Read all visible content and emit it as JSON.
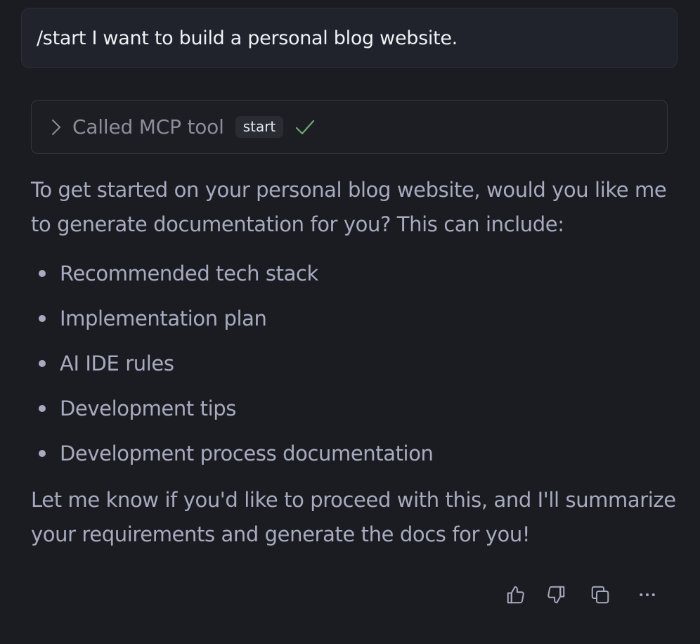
{
  "user_message": {
    "text": "/start I want to build a personal blog website."
  },
  "tool_call": {
    "label": "Called MCP tool",
    "tool_name": "start",
    "status": "success",
    "icons": {
      "expand": "chevron-right-icon",
      "status": "checkmark-icon"
    },
    "status_color": "#6aa874"
  },
  "assistant_message": {
    "intro": "To get started on your personal blog website, would you like me to generate documentation for you? This can include:",
    "items": [
      "Recommended tech stack",
      "Implementation plan",
      "AI IDE rules",
      "Development tips",
      "Development process documentation"
    ],
    "outro": "Let me know if you'd like to proceed with this, and I'll summarize your requirements and generate the docs for you!"
  },
  "actions": [
    {
      "name": "thumbs-up",
      "icon": "thumbs-up-icon"
    },
    {
      "name": "thumbs-down",
      "icon": "thumbs-down-icon"
    },
    {
      "name": "copy",
      "icon": "copy-icon"
    },
    {
      "name": "more",
      "icon": "more-horizontal-icon"
    }
  ],
  "colors": {
    "background": "#1b1c21",
    "user_bubble": "#20232b",
    "text_primary": "#eef0f4",
    "text_secondary": "#a7abc0"
  }
}
